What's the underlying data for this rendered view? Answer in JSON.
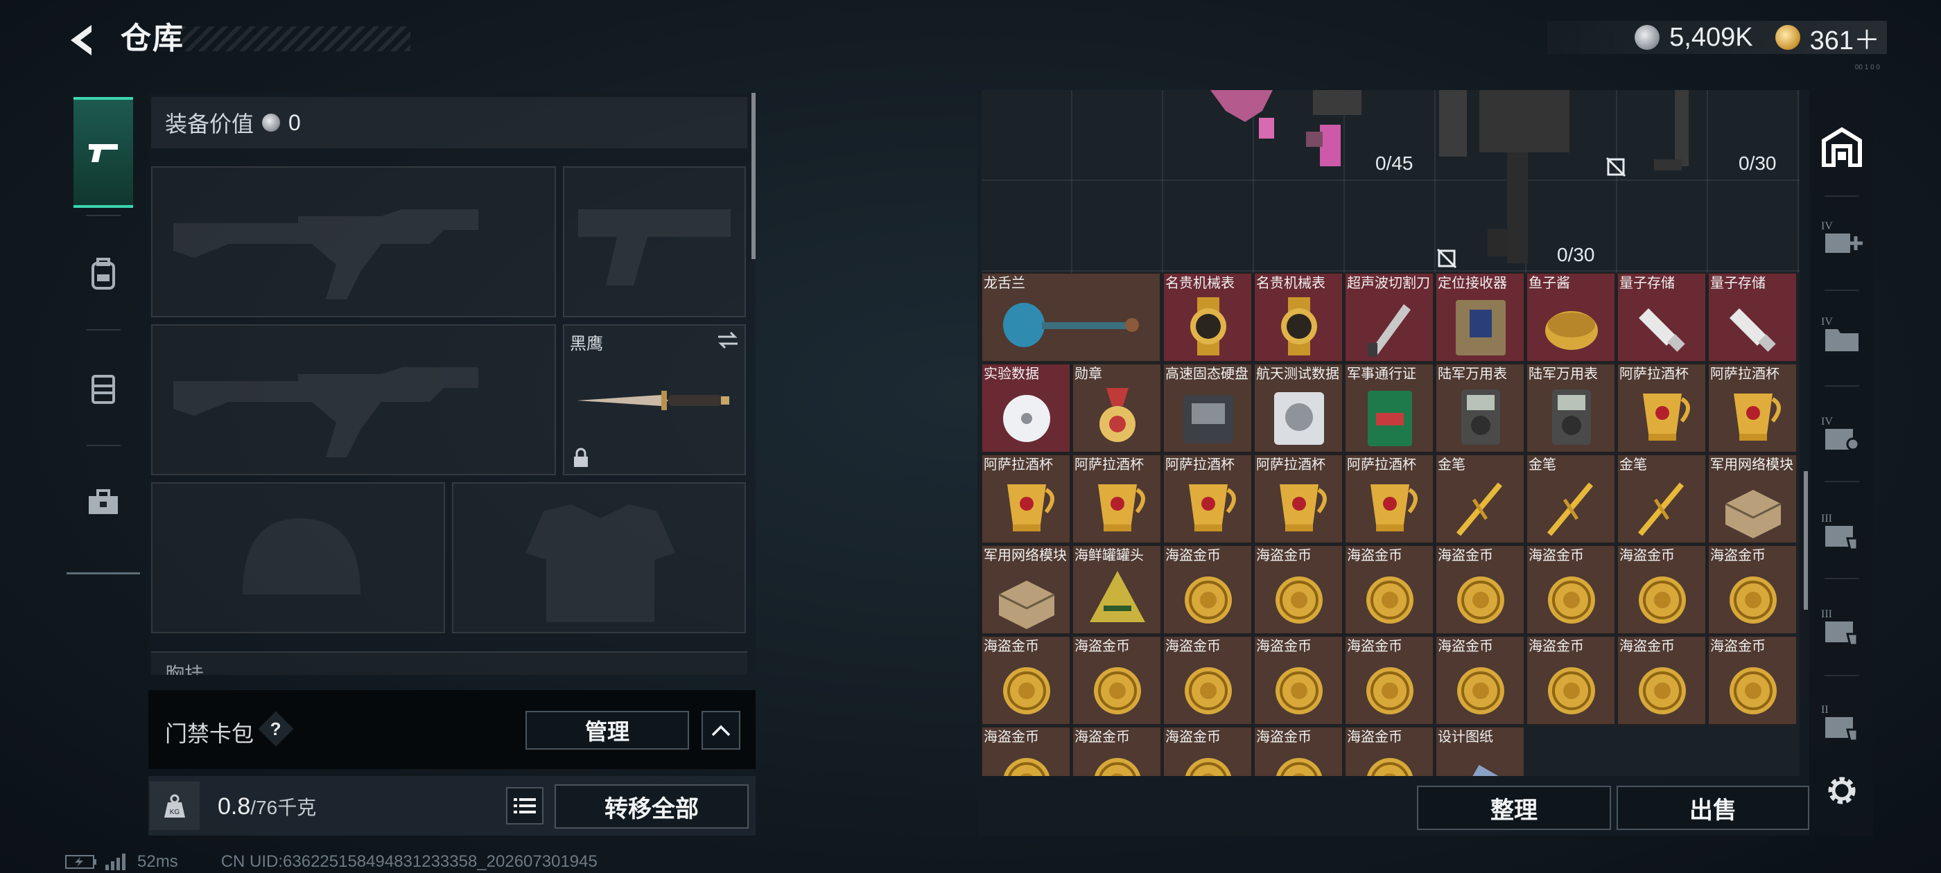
{
  "header": {
    "title": "仓库",
    "currency": [
      {
        "icon": "silver-coin-icon",
        "value": "5,409K"
      },
      {
        "icon": "gold-coin-icon",
        "value": "361＋"
      }
    ],
    "version": "00 1 0 0"
  },
  "left_nav": [
    {
      "icon": "pistol-icon",
      "active": true
    },
    {
      "icon": "backpack-icon",
      "active": false
    },
    {
      "icon": "vest-icon",
      "active": false
    },
    {
      "icon": "toolbox-icon",
      "active": false
    }
  ],
  "equipment": {
    "value_label": "装备价值",
    "value": "0",
    "melee_name": "黑鹰",
    "chest_label": "胸挂",
    "chest_help": "?"
  },
  "keycard": {
    "label": "门禁卡包",
    "help": "?",
    "manage_label": "管理"
  },
  "weight": {
    "current": "0.8",
    "max": "/76千克"
  },
  "transfer_all_label": "转移全部",
  "status": {
    "ping": "52ms",
    "uid": "CN UID:636225158494831233358_202607301945"
  },
  "stash": {
    "capacities": [
      "0/45",
      "0/30",
      "0/30"
    ],
    "rows": [
      [
        "龙舌兰",
        "名贵机械表",
        "名贵机械表",
        "超声波切割刀",
        "定位接收器",
        "鱼子酱",
        "量子存储",
        "量子存储"
      ],
      [
        "实验数据",
        "勋章",
        "高速固态硬盘",
        "航天测试数据",
        "军事通行证",
        "陆军万用表",
        "陆军万用表",
        "阿萨拉酒杯",
        "阿萨拉酒杯"
      ],
      [
        "阿萨拉酒杯",
        "阿萨拉酒杯",
        "阿萨拉酒杯",
        "阿萨拉酒杯",
        "阿萨拉酒杯",
        "金笔",
        "金笔",
        "金笔",
        "军用网络模块"
      ],
      [
        "军用网络模块",
        "海鲜罐罐头",
        "海盗金币",
        "海盗金币",
        "海盗金币",
        "海盗金币",
        "海盗金币",
        "海盗金币",
        "海盗金币"
      ],
      [
        "海盗金币",
        "海盗金币",
        "海盗金币",
        "海盗金币",
        "海盗金币",
        "海盗金币",
        "海盗金币",
        "海盗金币",
        "海盗金币"
      ],
      [
        "海盗金币",
        "海盗金币",
        "海盗金币",
        "海盗金币",
        "海盗金币",
        "设计图纸"
      ]
    ]
  },
  "actions": {
    "sort_label": "整理",
    "sell_label": "出售"
  },
  "right_bar": [
    {
      "icon": "home-icon"
    },
    {
      "icon": "tier-iv-add-icon"
    },
    {
      "icon": "tier-iv-folder-icon"
    },
    {
      "icon": "tier-iv-medkit-icon"
    },
    {
      "icon": "tier-iii-hand-icon"
    },
    {
      "icon": "tier-iii-hand-icon"
    },
    {
      "icon": "tier-ii-hand-icon"
    },
    {
      "icon": "gear-icon"
    }
  ],
  "colors": {
    "accent": "#3ad6b0",
    "item_bg": "#4f3931",
    "item_bg_red": "#6a2a33",
    "gold": "#d8a93a"
  }
}
